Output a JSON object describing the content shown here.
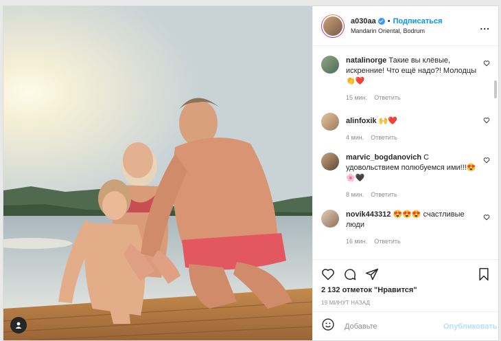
{
  "header": {
    "username": "a030aa",
    "follow_label": "Подписаться",
    "dot": "•",
    "location": "Mandarin Oriental, Bodrum",
    "more_label": "..."
  },
  "comments": [
    {
      "user": "natalinorge",
      "text": "Такие вы клёвые, искренние! Что ещё надо?! Молодцы 👏❤️",
      "time": "15 мин.",
      "reply": "Ответить"
    },
    {
      "user": "alinfoxik",
      "text": "🙌❤️",
      "time": "4 мин.",
      "reply": "Ответить"
    },
    {
      "user": "marvic_bogdanovich",
      "text": "С удовольствием полюбуемся ими!!!😍🌸🖤",
      "time": "8 мин.",
      "reply": "Ответить"
    },
    {
      "user": "novik443312",
      "text": "😍😍😍 счастливые люди",
      "time": "16 мин.",
      "reply": "Ответить"
    }
  ],
  "likes_text": "2 132 отметок \"Нравится\"",
  "posted_time": "19 МИНУТ НАЗАД",
  "composer": {
    "placeholder": "Добавьте",
    "publish_label": "Опубликовать"
  }
}
